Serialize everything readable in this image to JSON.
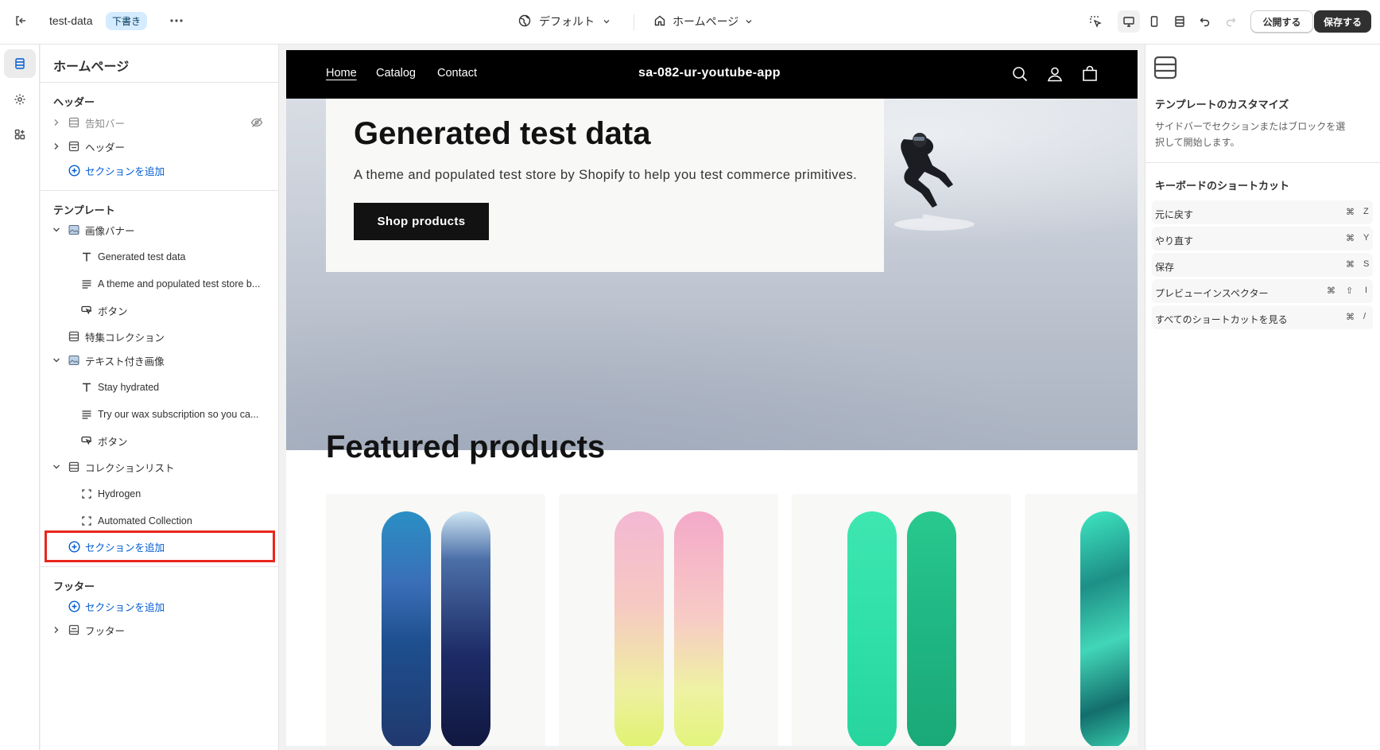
{
  "topbar": {
    "store_name": "test-data",
    "draft_badge": "下書き",
    "theme_selector": "デフォルト",
    "page_selector": "ホームページ",
    "publish_label": "公開する",
    "save_label": "保存する"
  },
  "sidebar": {
    "title": "ホームページ",
    "header_group": {
      "heading": "ヘッダー",
      "items": [
        {
          "label": "告知バー"
        },
        {
          "label": "ヘッダー"
        }
      ],
      "add_section": "セクションを追加"
    },
    "template_group": {
      "heading": "テンプレート",
      "image_banner": {
        "label": "画像バナー",
        "blocks": [
          "Generated test data",
          "A theme and populated test store b...",
          "ボタン"
        ]
      },
      "featured_collection": "特集コレクション",
      "image_with_text": {
        "label": "テキスト付き画像",
        "blocks": [
          "Stay hydrated",
          "Try our wax subscription so you ca...",
          "ボタン"
        ]
      },
      "collection_list": {
        "label": "コレクションリスト",
        "blocks": [
          "Hydrogen",
          "Automated Collection"
        ]
      },
      "add_section": "セクションを追加"
    },
    "footer_group": {
      "heading": "フッター",
      "add_section": "セクションを追加",
      "items": [
        {
          "label": "フッター"
        }
      ]
    }
  },
  "preview": {
    "nav": [
      "Home",
      "Catalog",
      "Contact"
    ],
    "brand": "sa-082-ur-youtube-app",
    "hero": {
      "heading": "Generated test data",
      "subheading": "A theme and populated test store by Shopify to help you test commerce primitives.",
      "button": "Shop products"
    },
    "featured_title": "Featured products"
  },
  "right_panel": {
    "title": "テンプレートのカスタマイズ",
    "description": "サイドバーでセクションまたはブロックを選択して開始します。",
    "shortcuts_heading": "キーボードのショートカット",
    "shortcuts": [
      {
        "label": "元に戻す",
        "keys": [
          "⌘",
          "Z"
        ]
      },
      {
        "label": "やり直す",
        "keys": [
          "⌘",
          "Y"
        ]
      },
      {
        "label": "保存",
        "keys": [
          "⌘",
          "S"
        ]
      },
      {
        "label": "プレビューインスペクター",
        "keys": [
          "⌘",
          "⇧",
          "I"
        ]
      },
      {
        "label": "すべてのショートカットを見る",
        "keys": [
          "⌘",
          "/"
        ]
      }
    ]
  },
  "colors": {
    "accent_link": "#005bd3",
    "highlight_box": "#e8261c",
    "save_button": "#303030",
    "storefront_header": "#000000"
  }
}
